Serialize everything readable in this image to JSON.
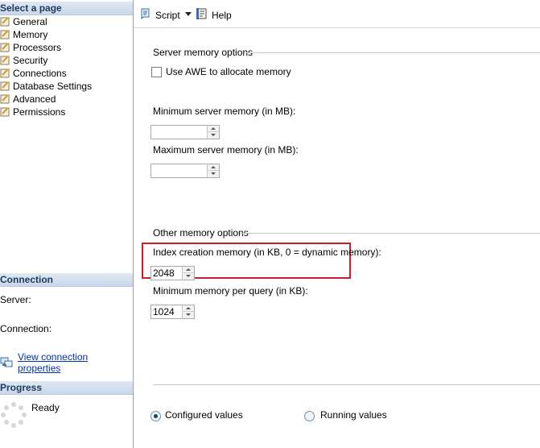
{
  "sidebar": {
    "select_page_title": "Select a page",
    "pages": [
      {
        "label": "General"
      },
      {
        "label": "Memory"
      },
      {
        "label": "Processors"
      },
      {
        "label": "Security"
      },
      {
        "label": "Connections"
      },
      {
        "label": "Database Settings"
      },
      {
        "label": "Advanced"
      },
      {
        "label": "Permissions"
      }
    ],
    "connection_title": "Connection",
    "server_label": "Server:",
    "connection_label": "Connection:",
    "view_connection_link": "View connection properties",
    "progress_title": "Progress",
    "progress_status": "Ready"
  },
  "toolbar": {
    "script_label": "Script",
    "help_label": "Help"
  },
  "memory": {
    "server_options_title": "Server memory options",
    "awe_checkbox_label": "Use AWE to allocate memory",
    "awe_checked": false,
    "min_server_label": "Minimum server memory (in MB):",
    "min_server_value": "",
    "max_server_label": "Maximum server memory (in MB):",
    "max_server_value": "",
    "other_options_title": "Other memory options",
    "index_creation_label": "Index creation memory (in KB, 0 = dynamic memory):",
    "index_creation_value": "2048",
    "min_query_label": "Minimum memory per query (in KB):",
    "min_query_value": "1024",
    "configured_values_label": "Configured values",
    "running_values_label": "Running values",
    "selected_view": "Configured values"
  }
}
